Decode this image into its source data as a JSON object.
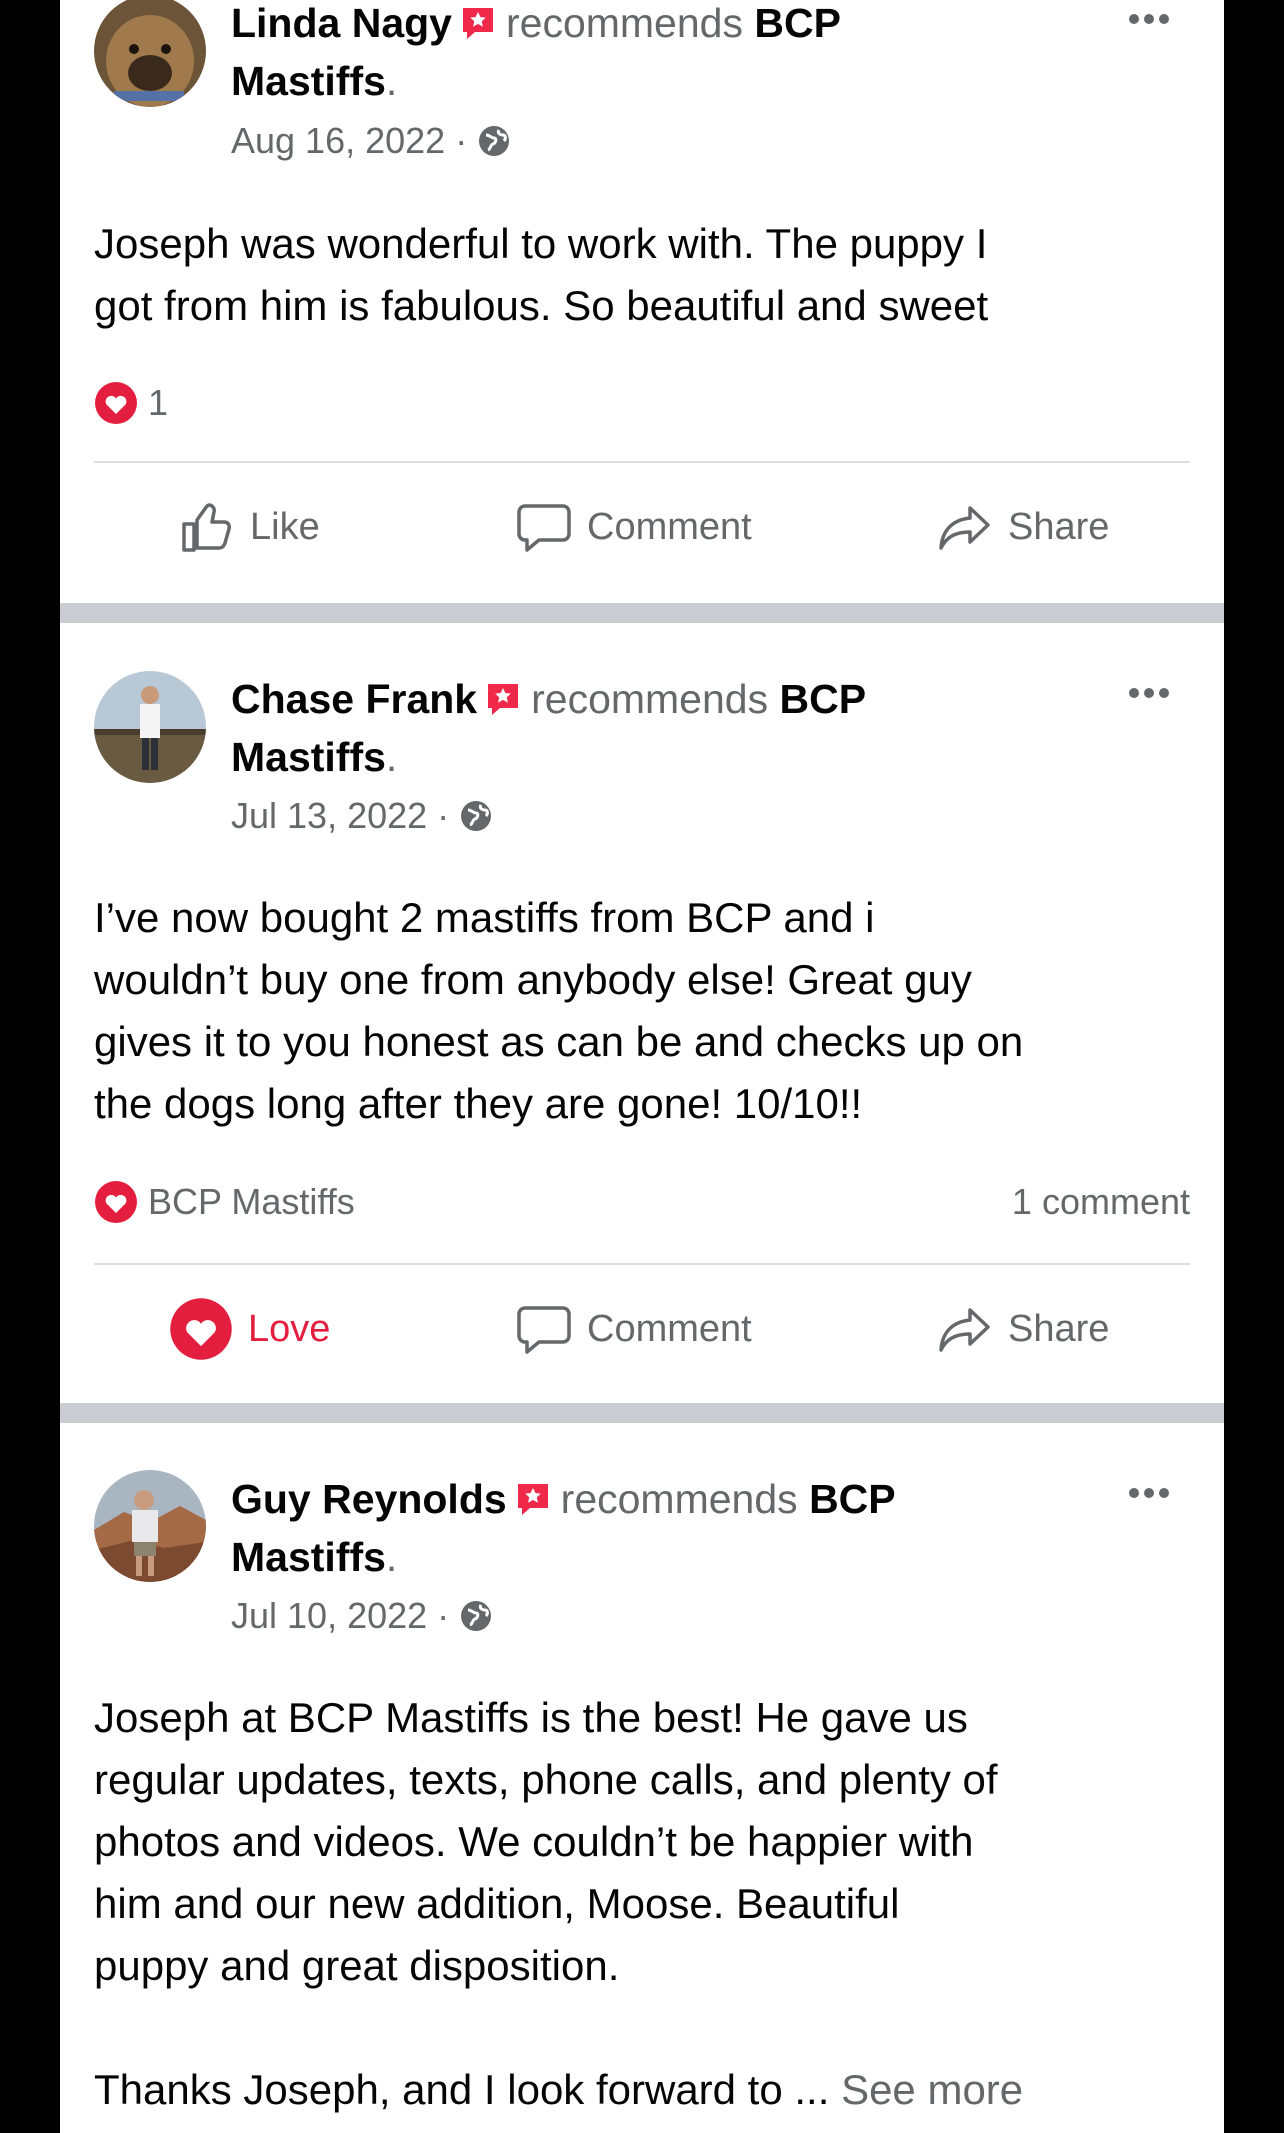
{
  "posts": [
    {
      "author": "Linda Nagy",
      "recommends_text": "recommends",
      "page_name": "BCP",
      "page_name_cont": "Mastiffs",
      "date": "Aug 16, 2022 ·",
      "body": [
        "Joseph was wonderful to work with. The puppy I",
        "got from him is fabulous. So beautiful and sweet"
      ],
      "reaction_count": "1",
      "actions": {
        "like": "Like",
        "comment": "Comment",
        "share": "Share"
      }
    },
    {
      "author": "Chase Frank",
      "recommends_text": "recommends",
      "page_name": "BCP",
      "page_name_cont": "Mastiffs",
      "date": "Jul 13, 2022 ·",
      "body": [
        "I’ve now bought 2 mastiffs from BCP and i",
        "wouldn’t buy one from anybody else! Great guy",
        "gives it to you honest as can be and checks up on",
        "the dogs long after they are gone! 10/10!!"
      ],
      "reaction_label": "BCP Mastiffs",
      "comment_count": "1 comment",
      "actions": {
        "love": "Love",
        "comment": "Comment",
        "share": "Share"
      }
    },
    {
      "author": "Guy Reynolds",
      "recommends_text": "recommends",
      "page_name": "BCP",
      "page_name_cont": "Mastiffs",
      "date": "Jul 10, 2022 ·",
      "body": [
        "Joseph at BCP Mastiffs is the best!  He gave us",
        "regular updates, texts, phone calls, and plenty of",
        "photos and videos. We couldn’t be happier with",
        "him and our new addition, Moose.  Beautiful",
        "puppy and great disposition."
      ],
      "body2": "Thanks Joseph, and I look forward to ...",
      "see_more": "See more"
    }
  ],
  "colors": {
    "love": "#e41e3f",
    "recommend_badge": "#f02849",
    "secondary_text": "#65676b",
    "separator": "#c9ccd1"
  },
  "icons": [
    "star-badge-icon",
    "globe-icon",
    "more-options-icon",
    "like-icon",
    "comment-icon",
    "share-icon",
    "love-reaction-icon"
  ]
}
